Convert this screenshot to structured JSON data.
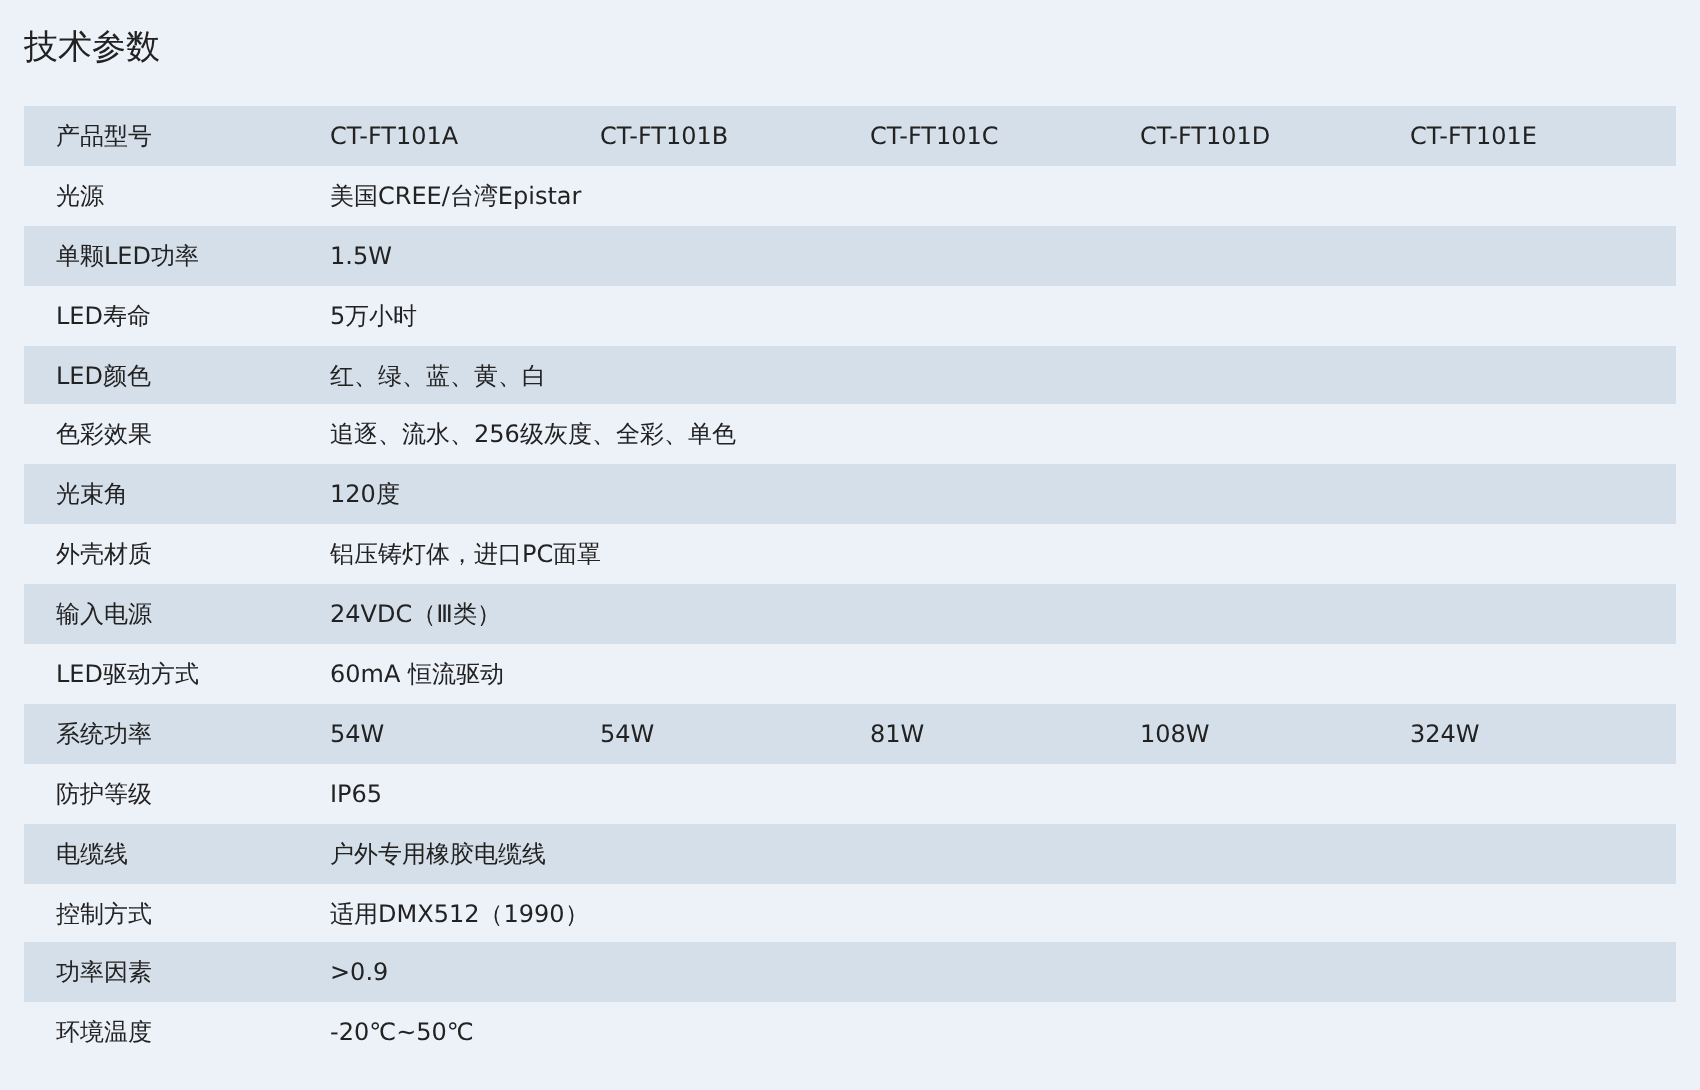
{
  "title": "技术参数",
  "table": {
    "rows": [
      {
        "label": "产品型号",
        "values": [
          "CT-FT101A",
          "CT-FT101B",
          "CT-FT101C",
          "CT-FT101D",
          "CT-FT101E"
        ]
      },
      {
        "label": "光源",
        "values": [
          "美国CREE/台湾Epistar"
        ]
      },
      {
        "label": "单颗LED功率",
        "values": [
          "1.5W"
        ]
      },
      {
        "label": "LED寿命",
        "values": [
          "5万小时"
        ]
      },
      {
        "label": "LED颜色",
        "values": [
          "红、绿、蓝、黄、白"
        ]
      },
      {
        "label": "色彩效果",
        "values": [
          "追逐、流水、256级灰度、全彩、单色"
        ]
      },
      {
        "label": "光束角",
        "values": [
          "120度"
        ]
      },
      {
        "label": "外壳材质",
        "values": [
          "铝压铸灯体，进口PC面罩"
        ]
      },
      {
        "label": "输入电源",
        "values": [
          "24VDC（Ⅲ类）"
        ]
      },
      {
        "label": "LED驱动方式",
        "values": [
          "60mA 恒流驱动"
        ]
      },
      {
        "label": "系统功率",
        "values": [
          "54W",
          "54W",
          "81W",
          "108W",
          "324W"
        ]
      },
      {
        "label": "防护等级",
        "values": [
          "IP65"
        ]
      },
      {
        "label": "电缆线",
        "values": [
          "户外专用橡胶电缆线"
        ]
      },
      {
        "label": "控制方式",
        "values": [
          "适用DMX512（1990）"
        ]
      },
      {
        "label": "功率因素",
        "values": [
          ">0.9"
        ]
      },
      {
        "label": "环境温度",
        "values": [
          "-20℃~50℃"
        ]
      }
    ]
  }
}
